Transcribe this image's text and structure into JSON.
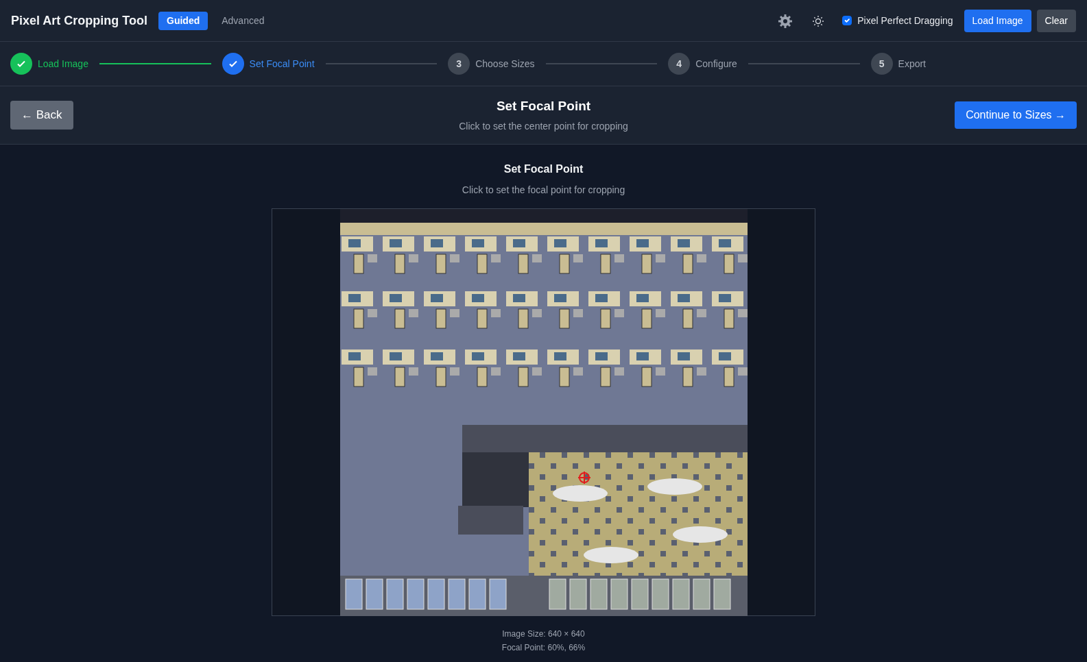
{
  "app_title": "Pixel Art Cropping Tool",
  "modes": [
    {
      "label": "Guided",
      "selected": true
    },
    {
      "label": "Advanced",
      "selected": false
    }
  ],
  "pixel_perfect": {
    "label": "Pixel Perfect Dragging",
    "checked": true
  },
  "header_buttons": [
    "Load Image",
    "Clear"
  ],
  "steps": [
    {
      "label": "Load Image",
      "completed": true,
      "selected": false
    },
    {
      "label": "Set Focal Point",
      "completed": true,
      "selected": true
    },
    {
      "number": "3",
      "label": "Choose Sizes",
      "completed": false,
      "selected": false
    },
    {
      "number": "4",
      "label": "Configure",
      "completed": false,
      "selected": false
    },
    {
      "number": "5",
      "label": "Export",
      "completed": false,
      "selected": false
    }
  ],
  "step_bar": {
    "back": "← Back",
    "title": "Set Focal Point",
    "subtitle": "Click to set the center point for cropping",
    "continue": "Continue to Sizes →"
  },
  "panel": {
    "title": "Set Focal Point",
    "subtitle": "Click to set the focal point for cropping",
    "image_size": "Image Size: 640 × 640",
    "focal_point": "Focal Point: 60%, 66%"
  }
}
